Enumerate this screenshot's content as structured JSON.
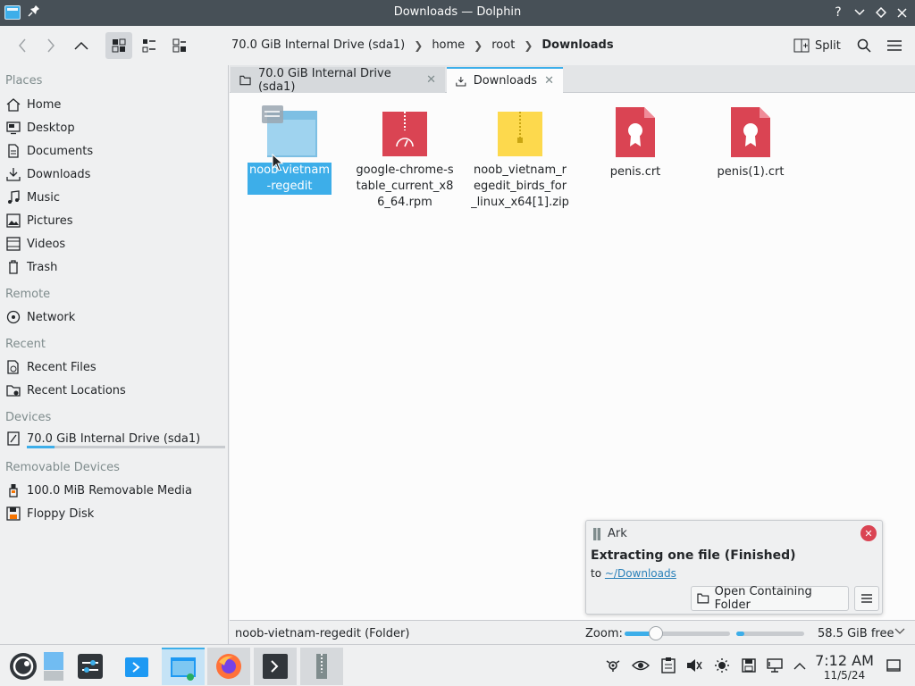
{
  "window": {
    "title": "Downloads — Dolphin"
  },
  "breadcrumb": {
    "items": [
      "70.0 GiB Internal Drive (sda1)",
      "home",
      "root",
      "Downloads"
    ]
  },
  "toolbar": {
    "split_label": "Split"
  },
  "sidebar": {
    "places_title": "Places",
    "places": [
      "Home",
      "Desktop",
      "Documents",
      "Downloads",
      "Music",
      "Pictures",
      "Videos",
      "Trash"
    ],
    "remote_title": "Remote",
    "remote": [
      "Network"
    ],
    "recent_title": "Recent",
    "recent": [
      "Recent Files",
      "Recent Locations"
    ],
    "devices_title": "Devices",
    "devices": [
      "70.0 GiB Internal Drive (sda1)"
    ],
    "drive_usage_fraction": 0.14,
    "removable_title": "Removable Devices",
    "removable": [
      "100.0 MiB Removable Media",
      "Floppy Disk"
    ]
  },
  "tabs": [
    {
      "label": "70.0 GiB Internal Drive (sda1)",
      "active": false
    },
    {
      "label": "Downloads",
      "active": true
    }
  ],
  "files": [
    {
      "name": "noob-vietnam-regedit",
      "type": "folder",
      "selected": true
    },
    {
      "name": "google-chrome-stable_current_x86_64.rpm",
      "type": "rpm",
      "selected": false
    },
    {
      "name": "noob_vietnam_regedit_birds_for_linux_x64[1].zip",
      "type": "zip",
      "selected": false
    },
    {
      "name": "penis.crt",
      "type": "certificate",
      "selected": false
    },
    {
      "name": "penis(1).crt",
      "type": "certificate",
      "selected": false
    }
  ],
  "statusbar": {
    "text": "noob-vietnam-regedit (Folder)",
    "zoom_label": "Zoom:",
    "zoom_level": 0.3,
    "free_space": "58.5 GiB free",
    "used_fraction": 0.12
  },
  "notification": {
    "app": "Ark",
    "title": "Extracting one file (Finished)",
    "body_prefix": "to",
    "body_link": "~/Downloads",
    "action_label": "Open Containing Folder"
  },
  "clock": {
    "time": "7:12 AM",
    "date": "11/5/24"
  },
  "colors": {
    "accent": "#3daee9",
    "titlebar": "#475057",
    "error": "#da4453"
  }
}
